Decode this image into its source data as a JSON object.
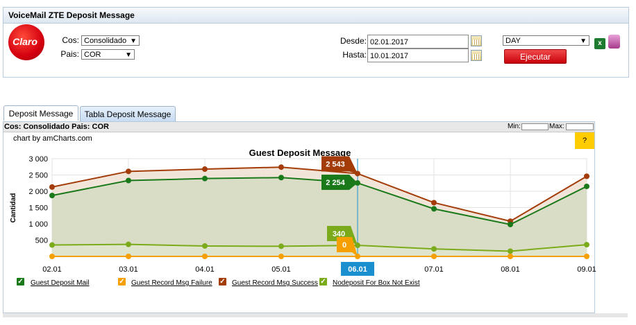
{
  "header": {
    "title": "VoiceMail ZTE Deposit Message"
  },
  "logo": {
    "text": "Claro"
  },
  "filters": {
    "cos_label": "Cos:",
    "cos_value": "Consolidado",
    "pais_label": "Pais:",
    "pais_value": "COR",
    "desde_label": "Desde:",
    "desde_value": "02.01.2017",
    "hasta_label": "Hasta:",
    "hasta_value": "10.01.2017",
    "period_value": "DAY",
    "run_label": "Ejecutar"
  },
  "tabs": [
    {
      "label": "Deposit Message",
      "active": true
    },
    {
      "label": "Tabla Deposit Message",
      "active": false
    }
  ],
  "chart_panel": {
    "subtitle": "Cos: Consolidado Pais: COR",
    "min_label": "Min:",
    "max_label": "Max:",
    "credit": "chart by amCharts.com",
    "help": "?"
  },
  "chart_data": {
    "type": "area",
    "title": "Guest Deposit Message",
    "ylabel": "Cantidad",
    "xlabel": "",
    "categories": [
      "02.01",
      "03.01",
      "04.01",
      "05.01",
      "06.01",
      "07.01",
      "08.01",
      "09.01"
    ],
    "ylim": [
      0,
      3000
    ],
    "yticks": [
      500,
      1000,
      1500,
      2000,
      2500,
      3000
    ],
    "ytick_labels": [
      "500",
      "1 000",
      "1 500",
      "2 000",
      "2 500",
      "3 000"
    ],
    "cursor_category": "06.01",
    "series": [
      {
        "name": "Guest Deposit Mail",
        "color": "#1a7a1a",
        "values": [
          1870,
          2330,
          2390,
          2420,
          2254,
          1460,
          980,
          2150
        ],
        "tooltip": "2 254"
      },
      {
        "name": "Guest Record Msg Failure",
        "color": "#f5a000",
        "values": [
          0,
          0,
          0,
          0,
          0,
          0,
          0,
          0
        ],
        "tooltip": "0"
      },
      {
        "name": "Guest Record Msg Success",
        "color": "#a33c08",
        "values": [
          2130,
          2610,
          2680,
          2740,
          2543,
          1650,
          1080,
          2460
        ],
        "tooltip": "2 543"
      },
      {
        "name": "Nodeposit For Box Not Exist",
        "color": "#7bab1a",
        "values": [
          350,
          370,
          320,
          310,
          340,
          230,
          160,
          360
        ],
        "tooltip": "340"
      }
    ]
  }
}
